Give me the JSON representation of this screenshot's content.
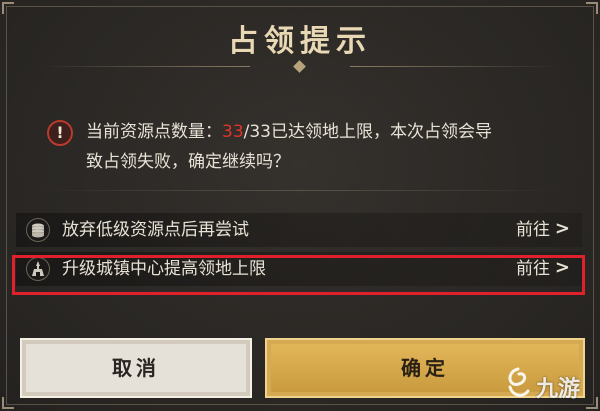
{
  "dialog": {
    "title": "占领提示",
    "message": {
      "prefix": "当前资源点数量：",
      "current": "33",
      "rest_line1": "/33已达领地上限，本次占领会导",
      "line2": "致占领失败，确定继续吗？"
    },
    "options": [
      {
        "label": "放弃低级资源点后再尝试",
        "action": "前往",
        "icon": "coin-stack-icon"
      },
      {
        "label": "升级城镇中心提高领地上限",
        "action": "前往",
        "icon": "town-center-icon"
      }
    ],
    "buttons": {
      "cancel": "取消",
      "confirm": "确定"
    }
  },
  "watermark": {
    "text": "九游"
  },
  "colors": {
    "highlight_red": "#e0342a",
    "confirm_gold": "#d9ab4e",
    "cancel_beige": "#e6e1d8",
    "panel_bg": "#2b2825"
  }
}
